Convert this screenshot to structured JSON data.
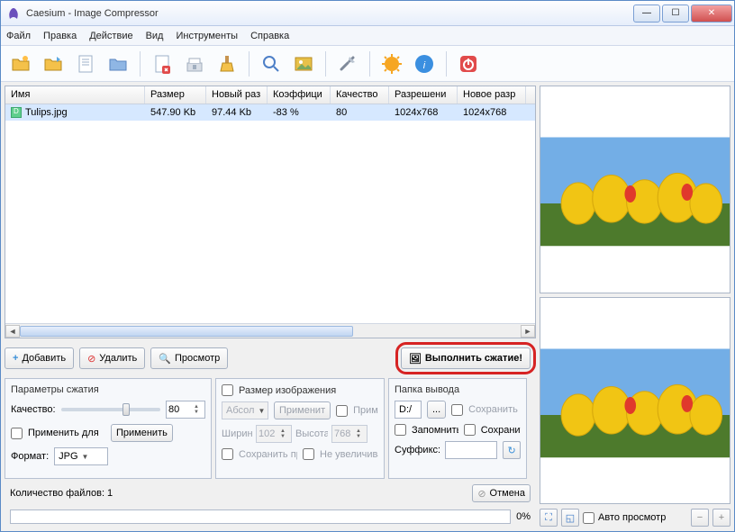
{
  "titlebar": {
    "title": "Caesium - Image Compressor"
  },
  "menu": {
    "file": "Файл",
    "edit": "Правка",
    "action": "Действие",
    "view": "Вид",
    "tools": "Инструменты",
    "help": "Справка"
  },
  "columns": {
    "name": "Имя",
    "size": "Размер",
    "newsize": "Новый раз",
    "ratio": "Коэффици",
    "quality": "Качество",
    "res": "Разрешени",
    "newres": "Новое разр"
  },
  "rows": [
    {
      "name": "Tulips.jpg",
      "size": "547.90 Kb",
      "newsize": "97.44 Kb",
      "ratio": "-83 %",
      "quality": "80",
      "res": "1024x768",
      "newres": "1024x768"
    }
  ],
  "buttons": {
    "add": "Добавить",
    "remove": "Удалить",
    "preview": "Просмотр",
    "compress": "Выполнить сжатие!",
    "apply": "Применить",
    "apply_short": "Применит",
    "cancel": "Отмена",
    "browse": "..."
  },
  "comp": {
    "panel_title": "Параметры сжатия",
    "quality_label": "Качество:",
    "quality_value": "80",
    "apply_all": "Применить для",
    "format_label": "Формат:",
    "format_value": "JPG"
  },
  "resize": {
    "panel_title": "Размер изображения",
    "abs": "Абсол",
    "apply": "Примен",
    "width_label": "Ширин",
    "width_value": "102",
    "height_label": "Высота",
    "height_value": "768",
    "keep_ratio": "Сохранить пр",
    "no_enlarge": "Не увеличива"
  },
  "output": {
    "panel_title": "Папка вывода",
    "path": "D:/",
    "keep_struct": "Сохранить стр",
    "remember": "Запомнить па",
    "save_in": "Сохранить в",
    "suffix_label": "Суффикс:",
    "suffix_value": ""
  },
  "status": {
    "count_label": "Количество файлов: 1",
    "progress_pct": "0%"
  },
  "previewctrl": {
    "auto": "Авто просмотр"
  }
}
